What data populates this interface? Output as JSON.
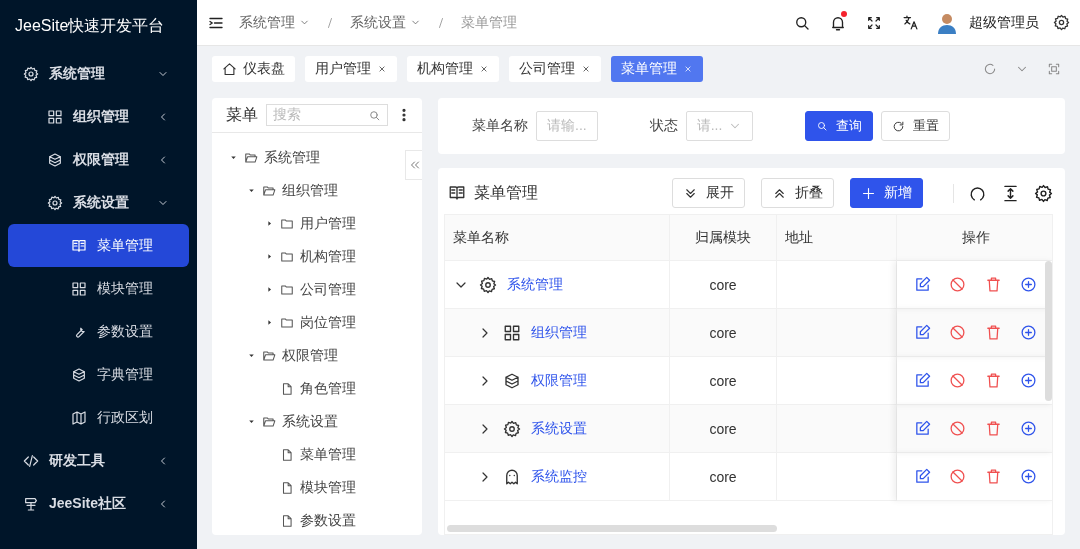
{
  "sidebar": {
    "logo": "JeeSite快速开发平台",
    "items": [
      {
        "label": "系统管理",
        "expanded": true,
        "selected": false,
        "children": [
          {
            "label": "组织管理",
            "expanded": false,
            "selected": false
          },
          {
            "label": "权限管理",
            "expanded": false,
            "selected": false
          },
          {
            "label": "系统设置",
            "expanded": true,
            "selected": false,
            "children": [
              {
                "label": "菜单管理",
                "selected": true
              },
              {
                "label": "模块管理",
                "selected": false
              },
              {
                "label": "参数设置",
                "selected": false
              },
              {
                "label": "字典管理",
                "selected": false
              },
              {
                "label": "行政区划",
                "selected": false
              }
            ]
          }
        ]
      },
      {
        "label": "研发工具",
        "expanded": false,
        "selected": false
      },
      {
        "label": "JeeSite社区",
        "expanded": false,
        "selected": false
      }
    ]
  },
  "header": {
    "breadcrumb": [
      {
        "label": "系统管理",
        "dropdown": true
      },
      {
        "label": "系统设置",
        "dropdown": true
      },
      {
        "label": "菜单管理",
        "dropdown": false
      }
    ],
    "notification_dot": true,
    "user": "超级管理员"
  },
  "tabs": [
    {
      "label": "仪表盘",
      "kind": "home",
      "closable": false,
      "selected": false
    },
    {
      "label": "用户管理",
      "kind": "page",
      "closable": true,
      "selected": false
    },
    {
      "label": "机构管理",
      "kind": "page",
      "closable": true,
      "selected": false
    },
    {
      "label": "公司管理",
      "kind": "page",
      "closable": true,
      "selected": false
    },
    {
      "label": "菜单管理",
      "kind": "page",
      "closable": true,
      "selected": true
    }
  ],
  "tree_panel": {
    "title": "菜单",
    "search": {
      "placeholder": "搜索"
    },
    "nodes": [
      {
        "label": "系统管理",
        "expanded": true,
        "children": [
          {
            "label": "组织管理",
            "expanded": true,
            "children": [
              {
                "label": "用户管理",
                "expanded": false
              },
              {
                "label": "机构管理",
                "expanded": false
              },
              {
                "label": "公司管理",
                "expanded": false
              },
              {
                "label": "岗位管理",
                "expanded": false
              }
            ]
          },
          {
            "label": "权限管理",
            "expanded": true,
            "children": [
              {
                "label": "角色管理"
              }
            ]
          },
          {
            "label": "系统设置",
            "expanded": true,
            "children": [
              {
                "label": "菜单管理"
              },
              {
                "label": "模块管理"
              },
              {
                "label": "参数设置"
              }
            ]
          }
        ]
      }
    ]
  },
  "search_form": {
    "fields": [
      {
        "label": "菜单名称",
        "kind": "input",
        "placeholder": "请输..."
      },
      {
        "label": "状态",
        "kind": "select",
        "placeholder": "请..."
      }
    ],
    "buttons": [
      {
        "label": "查询",
        "kind": "primary"
      },
      {
        "label": "重置",
        "kind": "default"
      }
    ]
  },
  "table_card": {
    "title": "菜单管理",
    "buttons": [
      {
        "label": "展开",
        "kind": "expand"
      },
      {
        "label": "折叠",
        "kind": "collapse"
      },
      {
        "label": "新增",
        "kind": "add"
      }
    ],
    "table": {
      "columns": [
        "菜单名称",
        "归属模块",
        "地址",
        "操作"
      ],
      "rows": [
        {
          "name": "系统管理",
          "module": "core",
          "expanded": true,
          "children": [
            {
              "name": "组织管理",
              "module": "core",
              "expanded": false
            },
            {
              "name": "权限管理",
              "module": "core",
              "expanded": false
            },
            {
              "name": "系统设置",
              "module": "core",
              "expanded": false
            },
            {
              "name": "系统监控",
              "module": "core",
              "expanded": false
            }
          ]
        }
      ]
    }
  }
}
